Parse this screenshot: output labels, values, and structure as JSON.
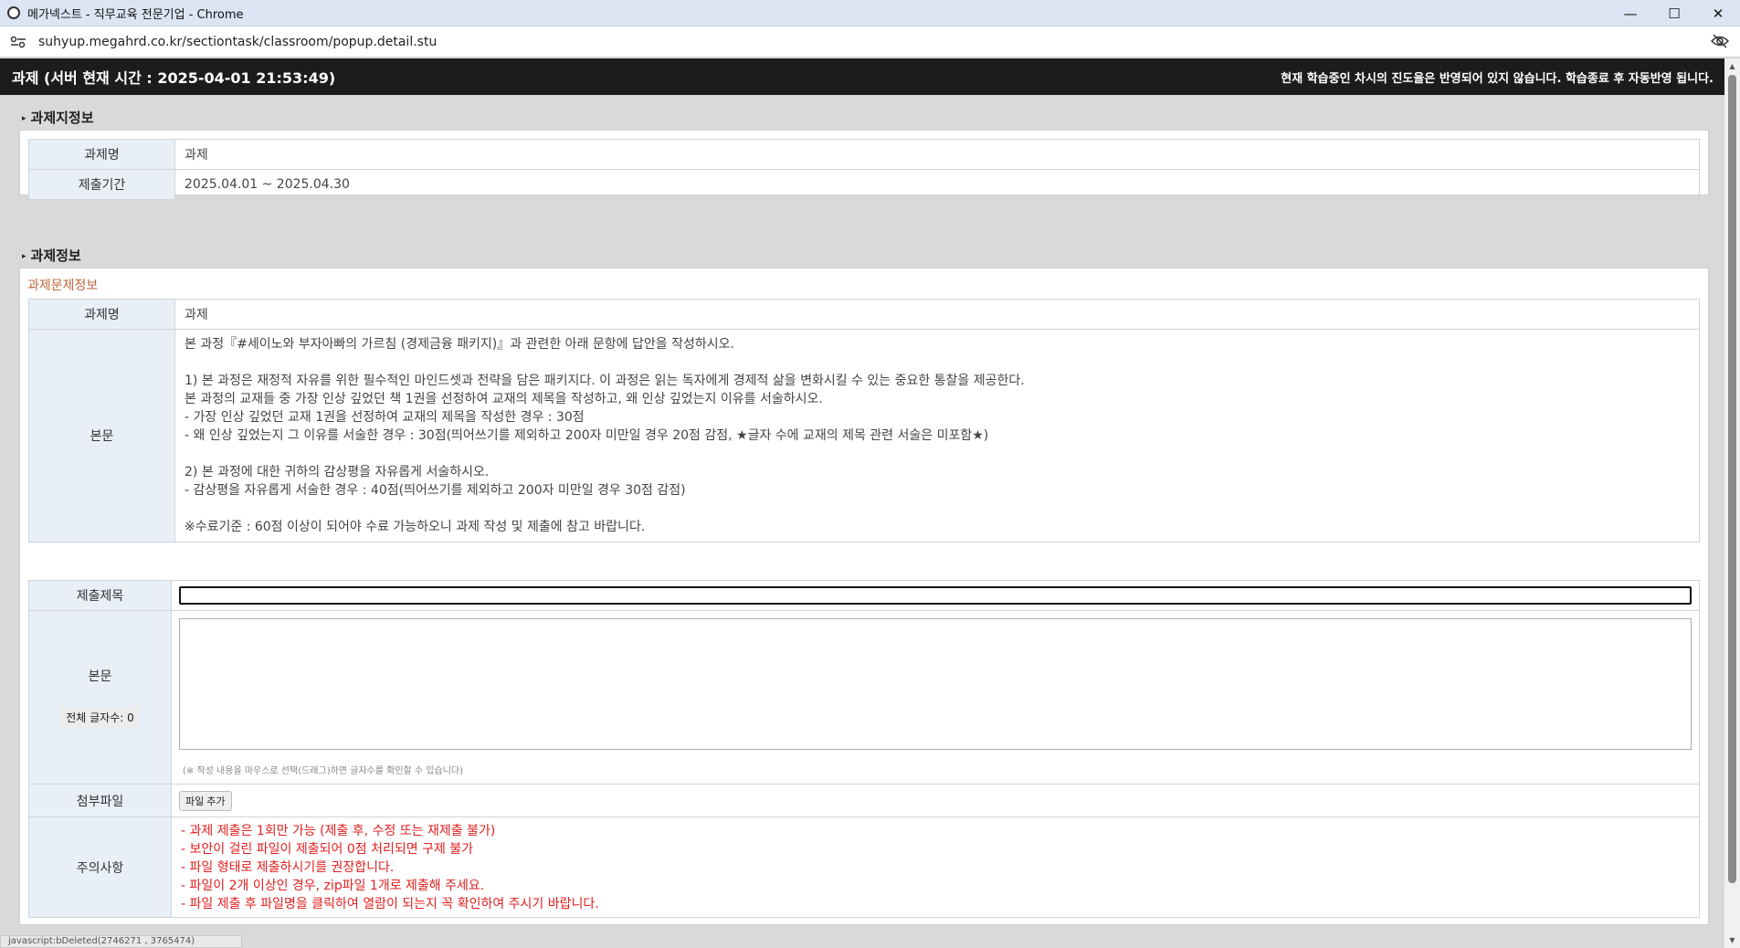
{
  "window": {
    "title": "메가넥스트 - 직무교육 전문기업 - Chrome",
    "minimize": "—",
    "maximize": "☐",
    "close": "✕"
  },
  "address": {
    "url": "suhyup.megahrd.co.kr/sectiontask/classroom/popup.detail.stu"
  },
  "header": {
    "title": "과제 (서버 현재 시간 : 2025-04-01 21:53:49)",
    "notice": "현재 학습중인 차시의 진도율은 반영되어 있지 않습니다. 학습종료 후 자동반영 됩니다."
  },
  "assignment_info": {
    "section_title": "과제지정보",
    "name_label": "과제명",
    "name_value": "과제",
    "period_label": "제출기간",
    "period_value": "2025.04.01 ~ 2025.04.30"
  },
  "task_info": {
    "section_title": "과제정보",
    "subtitle": "과제문제정보",
    "name_label": "과제명",
    "name_value": "과제",
    "body_label": "본문",
    "body_lines": [
      "본 과정『#세이노와 부자아빠의 가르침 (경제금융 패키지)』과 관련한 아래 문항에 답안을 작성하시오.",
      "",
      "1) 본 과정은 재정적 자유를 위한 필수적인 마인드셋과 전략을 담은 패키지다. 이 과정은 읽는 독자에게 경제적 삶을 변화시킬 수 있는 중요한 통찰을 제공한다.",
      "본 과정의 교재들 중 가장 인상 깊었던 책 1권을 선정하여 교재의 제목을 작성하고, 왜 인상 깊었는지 이유를 서술하시오.",
      "- 가장 인상 깊었던 교재 1권을 선정하여 교재의 제목을 작성한 경우 : 30점",
      "- 왜 인상 깊었는지 그 이유를 서술한 경우 : 30점(띄어쓰기를 제외하고 200자 미만일 경우 20점 감점, ★글자 수에 교재의 제목 관련 서술은 미포함★)",
      "",
      "2) 본 과정에 대한 귀하의 감상평을 자유롭게 서술하시오.",
      "- 감상평을 자유롭게 서술한 경우 : 40점(띄어쓰기를 제외하고 200자 미만일 경우 30점 감점)",
      "",
      "※수료기준 : 60점 이상이 되어야 수료 가능하오니 과제 작성 및 제출에 참고 바랍니다."
    ]
  },
  "submission": {
    "title_label": "제출제목",
    "title_value": "",
    "body_label": "본문",
    "char_count": "전체 글자수: 0",
    "body_value": "",
    "hint": "(※ 작성 내용을 마우스로 선택(드래그)하면 글자수를 확인할 수 있습니다)",
    "file_label": "첨부파일",
    "file_button": "파일 추가",
    "notes_label": "주의사항",
    "notes": [
      "- 과제 제출은 1회만 가능 (제출 후, 수정 또는 재제출 불가)",
      "- 보안이 걸린 파일이 제출되어 0점 처리되면 구제 불가",
      "- 파일 형태로 제출하시기를 권장합니다.",
      "- 파일이 2개 이상인 경우, zip파일 1개로 제출해 주세요.",
      "- 파일 제출 후 파일명을 클릭하여 열람이 되는지 꼭 확인하여 주시기 바랍니다."
    ]
  },
  "statusbar": {
    "text": "javascript:bDeleted(2746271 , 3765474)"
  },
  "colors": {
    "header_bg": "#1c1c1c",
    "label_bg": "#e8eff7",
    "subtitle": "#c0663c",
    "notice_red": "#e02020"
  }
}
